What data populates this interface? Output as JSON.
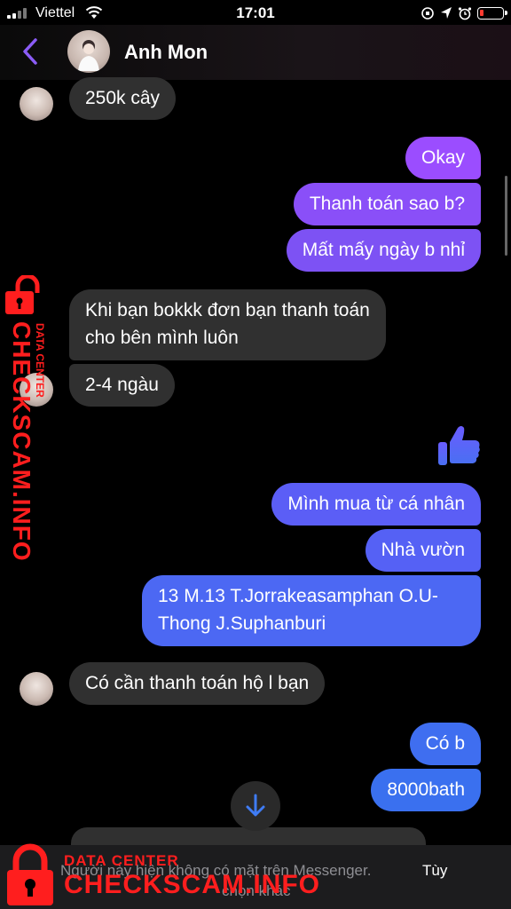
{
  "status_bar": {
    "carrier": "Viettel",
    "time": "17:01"
  },
  "header": {
    "contact_name": "Anh Mon"
  },
  "messages": [
    {
      "side": "in",
      "text": "250k cây"
    },
    {
      "side": "out",
      "text": "Okay"
    },
    {
      "side": "out",
      "text": "Thanh toán sao b?"
    },
    {
      "side": "out",
      "text": "Mất mấy ngày b nhỉ"
    },
    {
      "side": "in",
      "line1": "Khi bạn bokkk đơn bạn thanh toán",
      "line2": "cho bên mình luôn"
    },
    {
      "side": "in",
      "text": "2-4 ngàu"
    },
    {
      "side": "out",
      "type": "like"
    },
    {
      "side": "out",
      "text": "Mình mua từ cá nhân"
    },
    {
      "side": "out",
      "text": "Nhà vườn"
    },
    {
      "side": "out",
      "line1": "13 M.13 T.Jorrakeasamphan O.U-",
      "line2": "Thong J.Suphanburi"
    },
    {
      "side": "in",
      "text": "Có cần thanh toán hộ l bạn"
    },
    {
      "side": "out",
      "text": "Có b"
    },
    {
      "side": "out",
      "text": "8000bath"
    }
  ],
  "bottom_bar": {
    "notice": "Người này hiện không có mặt trên Messenger.",
    "more_label": "Tùy",
    "more_label_line2": "chọn khác"
  },
  "watermark": {
    "small": "DATA CENTER",
    "big": "CHECKSCAM.INFO"
  },
  "colors": {
    "outgoing_purple": "#7b4dff",
    "outgoing_blue": "#3f6ef0",
    "incoming": "#303030",
    "accent": "#8b5cf6",
    "watermark": "#ff1e1e"
  },
  "icons": [
    "signal-icon",
    "wifi-icon",
    "back-icon",
    "like-icon",
    "scroll-down-icon",
    "lock-icon",
    "battery-icon",
    "alarm-icon",
    "location-icon"
  ]
}
